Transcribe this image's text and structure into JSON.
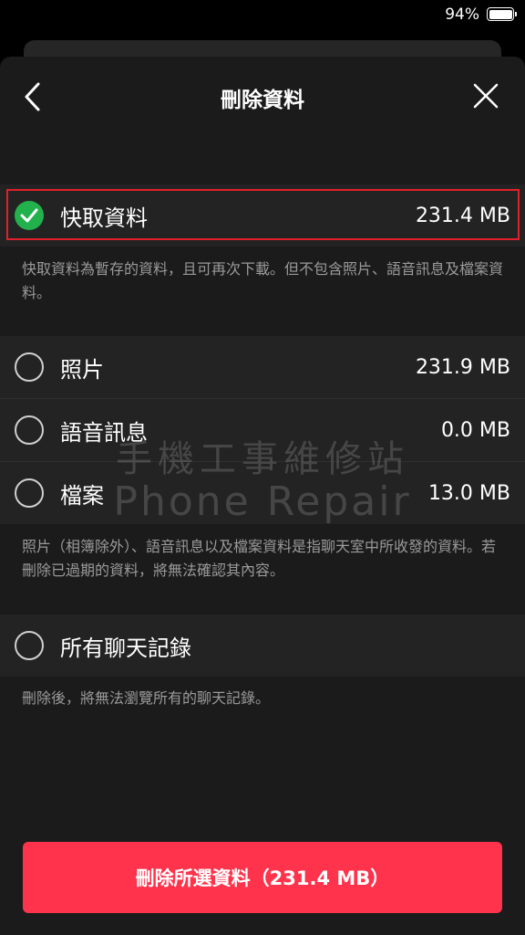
{
  "status_bar": {
    "battery_percent": "94%"
  },
  "header": {
    "title": "刪除資料"
  },
  "icons": {
    "back": "chevron-left-icon",
    "close": "close-icon",
    "checked": "check-icon"
  },
  "items": {
    "cache": {
      "label": "快取資料",
      "size": "231.4 MB",
      "checked": true
    },
    "photos": {
      "label": "照片",
      "size": "231.9 MB",
      "checked": false
    },
    "voice": {
      "label": "語音訊息",
      "size": "0.0 MB",
      "checked": false
    },
    "files": {
      "label": "檔案",
      "size": "13.0 MB",
      "checked": false
    },
    "all_chats": {
      "label": "所有聊天記錄",
      "checked": false
    }
  },
  "descriptions": {
    "cache": "快取資料為暫存的資料，且可再次下載。但不包含照片、語音訊息及檔案資料。",
    "media": "照片（相簿除外）、語音訊息以及檔案資料是指聊天室中所收發的資料。若刪除已過期的資料，將無法確認其內容。",
    "all_chats": "刪除後，將無法瀏覽所有的聊天記錄。"
  },
  "watermark": {
    "line1": "手機工事維修站",
    "line2": "Phone Repair"
  },
  "action": {
    "delete_label": "刪除所選資料（231.4 MB）"
  },
  "colors": {
    "accent_red": "#ff334b",
    "check_green": "#22b14c",
    "highlight_border": "#e0202a"
  }
}
